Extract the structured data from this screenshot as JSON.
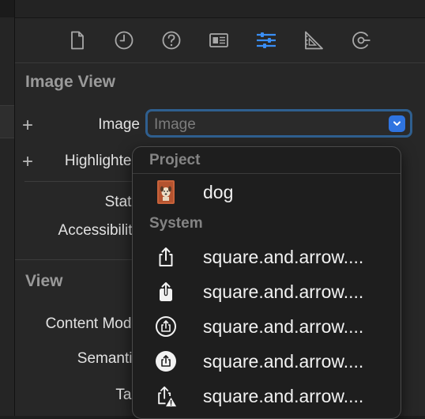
{
  "inspector_tabs": [
    {
      "icon": "file-icon"
    },
    {
      "icon": "history-clock-icon"
    },
    {
      "icon": "help-question-icon"
    },
    {
      "icon": "identity-card-icon"
    },
    {
      "icon": "attributes-sliders-icon",
      "selected": true
    },
    {
      "icon": "size-ruler-icon"
    },
    {
      "icon": "connections-icon"
    }
  ],
  "image_view": {
    "section_title": "Image View",
    "image_label": "Image",
    "image_placeholder": "Image",
    "highlighted_label": "Highlighted",
    "state_label": "State",
    "accessibility_label": "Accessibility"
  },
  "view": {
    "section_title": "View",
    "content_mode_label": "Content Mode",
    "semantic_label": "Semantic",
    "tag_label": "Tag"
  },
  "dropdown": {
    "project_header": "Project",
    "system_header": "System",
    "project_items": [
      {
        "label": "dog",
        "icon": "dog-thumbnail-icon"
      }
    ],
    "system_items": [
      {
        "label": "square.and.arrow....",
        "icon": "square-and-arrow-up-icon"
      },
      {
        "label": "square.and.arrow....",
        "icon": "square-and-arrow-up-fill-icon"
      },
      {
        "label": "square.and.arrow....",
        "icon": "square-and-arrow-up-circle-icon"
      },
      {
        "label": "square.and.arrow....",
        "icon": "square-and-arrow-up-circle-fill-icon"
      },
      {
        "label": "square.and.arrow....",
        "icon": "square-and-arrow-up-trianglebadge-icon"
      }
    ]
  },
  "colors": {
    "accent": "#2f74e0",
    "selected_tab": "#3a8ef5",
    "panel_background": "#272727",
    "menu_background": "#1e1e1e"
  }
}
